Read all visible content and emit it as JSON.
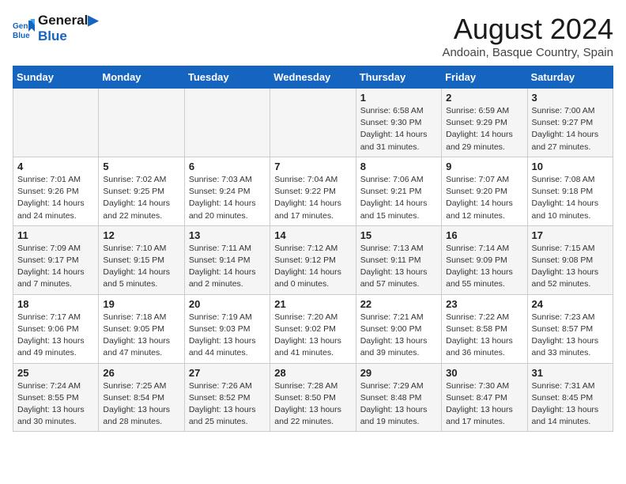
{
  "logo": {
    "line1": "General",
    "line2": "Blue"
  },
  "title": "August 2024",
  "subtitle": "Andoain, Basque Country, Spain",
  "weekdays": [
    "Sunday",
    "Monday",
    "Tuesday",
    "Wednesday",
    "Thursday",
    "Friday",
    "Saturday"
  ],
  "weeks": [
    [
      {
        "day": "",
        "info": ""
      },
      {
        "day": "",
        "info": ""
      },
      {
        "day": "",
        "info": ""
      },
      {
        "day": "",
        "info": ""
      },
      {
        "day": "1",
        "info": "Sunrise: 6:58 AM\nSunset: 9:30 PM\nDaylight: 14 hours and 31 minutes."
      },
      {
        "day": "2",
        "info": "Sunrise: 6:59 AM\nSunset: 9:29 PM\nDaylight: 14 hours and 29 minutes."
      },
      {
        "day": "3",
        "info": "Sunrise: 7:00 AM\nSunset: 9:27 PM\nDaylight: 14 hours and 27 minutes."
      }
    ],
    [
      {
        "day": "4",
        "info": "Sunrise: 7:01 AM\nSunset: 9:26 PM\nDaylight: 14 hours and 24 minutes."
      },
      {
        "day": "5",
        "info": "Sunrise: 7:02 AM\nSunset: 9:25 PM\nDaylight: 14 hours and 22 minutes."
      },
      {
        "day": "6",
        "info": "Sunrise: 7:03 AM\nSunset: 9:24 PM\nDaylight: 14 hours and 20 minutes."
      },
      {
        "day": "7",
        "info": "Sunrise: 7:04 AM\nSunset: 9:22 PM\nDaylight: 14 hours and 17 minutes."
      },
      {
        "day": "8",
        "info": "Sunrise: 7:06 AM\nSunset: 9:21 PM\nDaylight: 14 hours and 15 minutes."
      },
      {
        "day": "9",
        "info": "Sunrise: 7:07 AM\nSunset: 9:20 PM\nDaylight: 14 hours and 12 minutes."
      },
      {
        "day": "10",
        "info": "Sunrise: 7:08 AM\nSunset: 9:18 PM\nDaylight: 14 hours and 10 minutes."
      }
    ],
    [
      {
        "day": "11",
        "info": "Sunrise: 7:09 AM\nSunset: 9:17 PM\nDaylight: 14 hours and 7 minutes."
      },
      {
        "day": "12",
        "info": "Sunrise: 7:10 AM\nSunset: 9:15 PM\nDaylight: 14 hours and 5 minutes."
      },
      {
        "day": "13",
        "info": "Sunrise: 7:11 AM\nSunset: 9:14 PM\nDaylight: 14 hours and 2 minutes."
      },
      {
        "day": "14",
        "info": "Sunrise: 7:12 AM\nSunset: 9:12 PM\nDaylight: 14 hours and 0 minutes."
      },
      {
        "day": "15",
        "info": "Sunrise: 7:13 AM\nSunset: 9:11 PM\nDaylight: 13 hours and 57 minutes."
      },
      {
        "day": "16",
        "info": "Sunrise: 7:14 AM\nSunset: 9:09 PM\nDaylight: 13 hours and 55 minutes."
      },
      {
        "day": "17",
        "info": "Sunrise: 7:15 AM\nSunset: 9:08 PM\nDaylight: 13 hours and 52 minutes."
      }
    ],
    [
      {
        "day": "18",
        "info": "Sunrise: 7:17 AM\nSunset: 9:06 PM\nDaylight: 13 hours and 49 minutes."
      },
      {
        "day": "19",
        "info": "Sunrise: 7:18 AM\nSunset: 9:05 PM\nDaylight: 13 hours and 47 minutes."
      },
      {
        "day": "20",
        "info": "Sunrise: 7:19 AM\nSunset: 9:03 PM\nDaylight: 13 hours and 44 minutes."
      },
      {
        "day": "21",
        "info": "Sunrise: 7:20 AM\nSunset: 9:02 PM\nDaylight: 13 hours and 41 minutes."
      },
      {
        "day": "22",
        "info": "Sunrise: 7:21 AM\nSunset: 9:00 PM\nDaylight: 13 hours and 39 minutes."
      },
      {
        "day": "23",
        "info": "Sunrise: 7:22 AM\nSunset: 8:58 PM\nDaylight: 13 hours and 36 minutes."
      },
      {
        "day": "24",
        "info": "Sunrise: 7:23 AM\nSunset: 8:57 PM\nDaylight: 13 hours and 33 minutes."
      }
    ],
    [
      {
        "day": "25",
        "info": "Sunrise: 7:24 AM\nSunset: 8:55 PM\nDaylight: 13 hours and 30 minutes."
      },
      {
        "day": "26",
        "info": "Sunrise: 7:25 AM\nSunset: 8:54 PM\nDaylight: 13 hours and 28 minutes."
      },
      {
        "day": "27",
        "info": "Sunrise: 7:26 AM\nSunset: 8:52 PM\nDaylight: 13 hours and 25 minutes."
      },
      {
        "day": "28",
        "info": "Sunrise: 7:28 AM\nSunset: 8:50 PM\nDaylight: 13 hours and 22 minutes."
      },
      {
        "day": "29",
        "info": "Sunrise: 7:29 AM\nSunset: 8:48 PM\nDaylight: 13 hours and 19 minutes."
      },
      {
        "day": "30",
        "info": "Sunrise: 7:30 AM\nSunset: 8:47 PM\nDaylight: 13 hours and 17 minutes."
      },
      {
        "day": "31",
        "info": "Sunrise: 7:31 AM\nSunset: 8:45 PM\nDaylight: 13 hours and 14 minutes."
      }
    ]
  ]
}
